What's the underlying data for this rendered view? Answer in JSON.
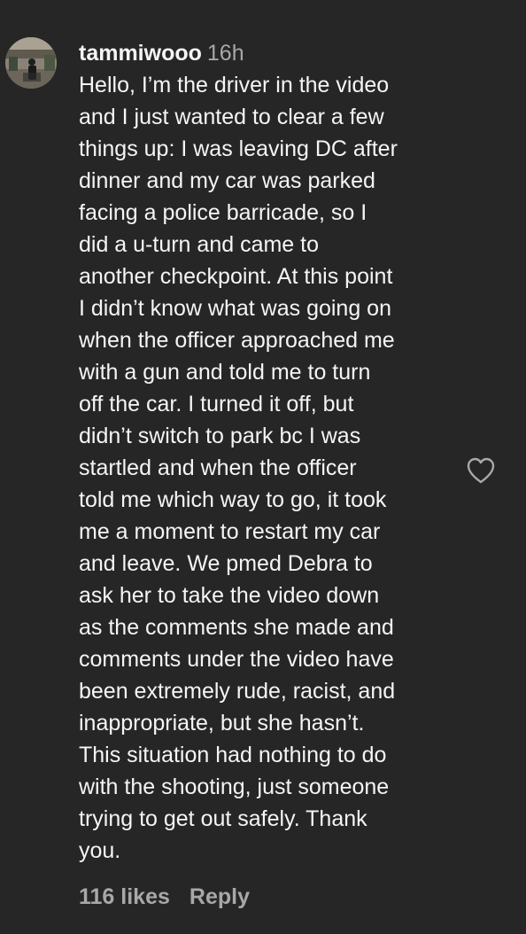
{
  "comment": {
    "username": "tammiwooo",
    "timestamp": "16h",
    "body_lines": [
      "Hello, I’m the driver in the video",
      "and I just wanted to clear a few",
      "things up: I was leaving DC after",
      "dinner and my car was parked",
      "facing a police barricade, so I",
      "did a u-turn and came to",
      "another checkpoint. At this point",
      "I didn’t know what was going on",
      "when the officer approached me",
      "with a gun and told me to turn",
      "off the car. I turned it off, but",
      "didn’t switch to park bc I was",
      "startled and when the officer",
      "told me which way to go, it took",
      "me a moment to restart my car",
      "and leave. We pmed Debra to",
      "ask her to take the video down",
      "as the comments she made and",
      "comments under the video have",
      "been extremely rude, racist, and",
      "inappropriate, but she hasn’t.",
      "This situation had nothing to do",
      "with the shooting, just someone",
      "trying to get out safely. Thank",
      "you."
    ],
    "likes_label": "116 likes",
    "reply_label": "Reply"
  },
  "icons": {
    "like": "heart-outline-icon",
    "avatar": "user-avatar"
  },
  "colors": {
    "background": "#262626",
    "primary_text": "#f5f5f5",
    "secondary_text": "#a8a8a8"
  }
}
